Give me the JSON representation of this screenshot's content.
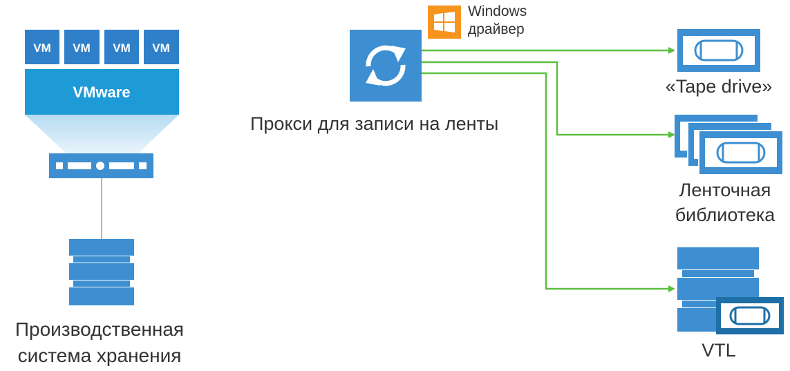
{
  "vms": {
    "labels": [
      "VM",
      "VM",
      "VM",
      "VM"
    ],
    "hypervisor_label": "VMware"
  },
  "storage": {
    "label_line1": "Производственная",
    "label_line2": "система хранения"
  },
  "proxy": {
    "label": "Прокси для записи на ленты",
    "driver_line1": "Windows",
    "driver_line2": "драйвер"
  },
  "targets": {
    "tape_drive": "«Tape drive»",
    "library_line1": "Ленточная",
    "library_line2": "библиотека",
    "vtl": "VTL"
  },
  "colors": {
    "vm_blue": "#2f80c8",
    "vmware_blue": "#1e9ad6",
    "icon_blue": "#3d8fd1",
    "connector_green": "#5cbf3f",
    "windows_orange": "#f7941d",
    "vtl_dark": "#1d6fa5"
  }
}
